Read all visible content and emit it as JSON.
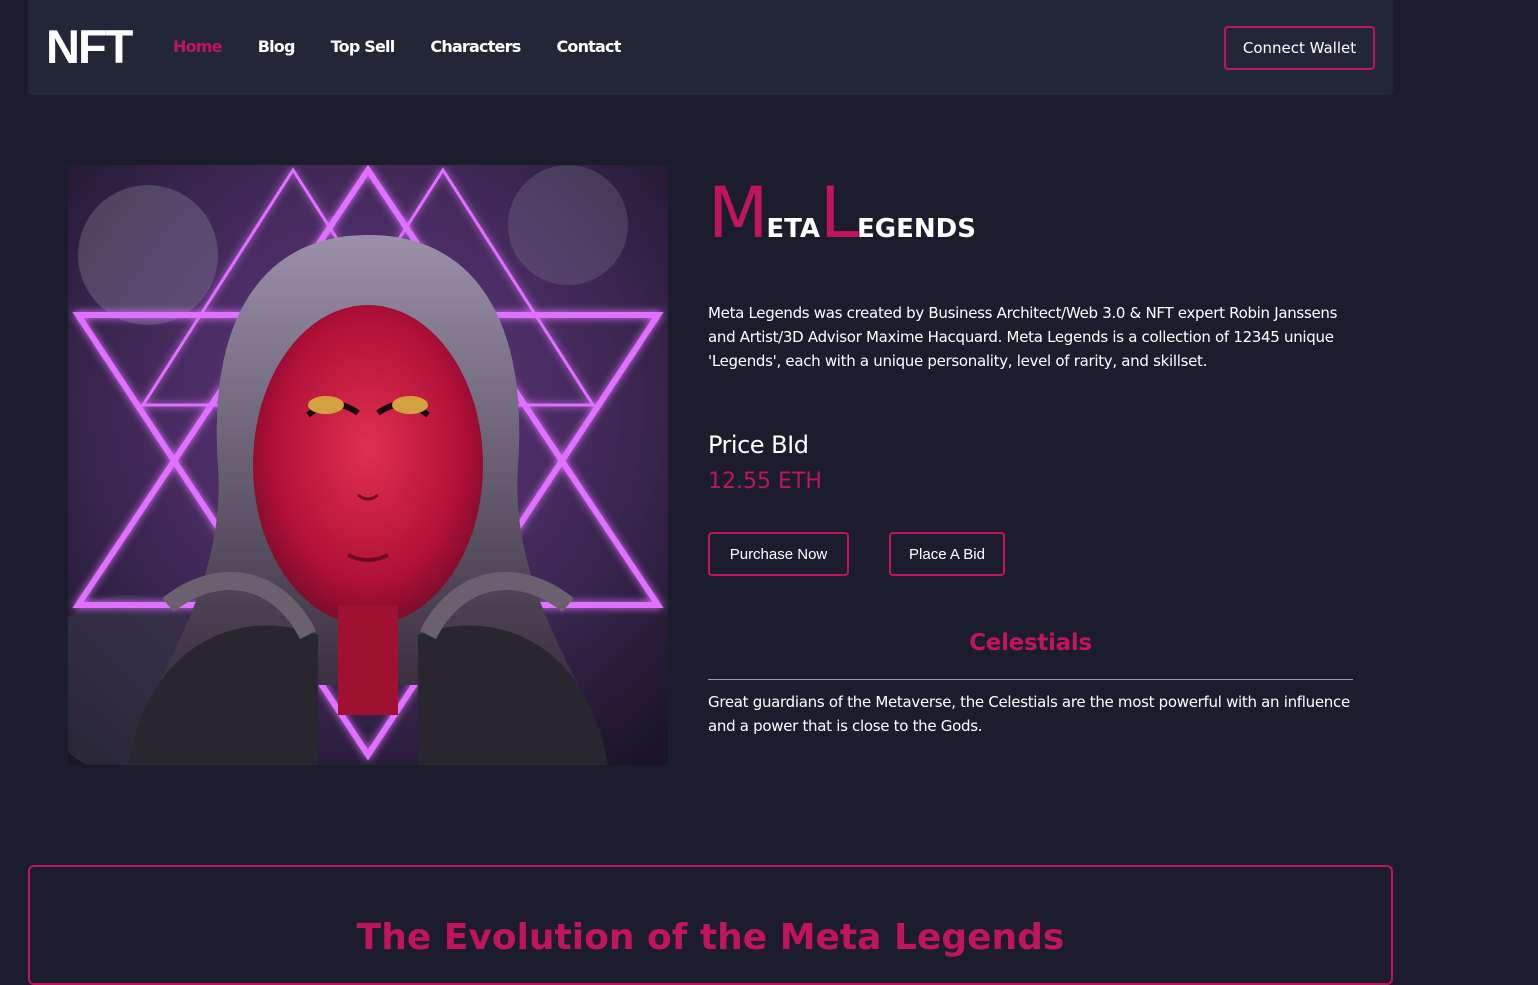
{
  "nav": {
    "logo": "NFT",
    "links": [
      {
        "label": "Home",
        "active": true
      },
      {
        "label": "Blog",
        "active": false
      },
      {
        "label": "Top Sell",
        "active": false
      },
      {
        "label": "Characters",
        "active": false
      },
      {
        "label": "Contact",
        "active": false
      }
    ],
    "connect_label": "Connect Wallet"
  },
  "hero": {
    "title_word1_cap": "M",
    "title_word1_rest": "ETA",
    "title_word2_cap": "L",
    "title_word2_rest": "EGENDS",
    "description": "Meta Legends was created by Business Architect/Web 3.0 & NFT expert Robin Janssens and Artist/3D Advisor Maxime Hacquard. Meta Legends is a collection of 12345 unique 'Legends', each with a unique personality, level of rarity, and skillset.",
    "price_label": "Price BId",
    "price_value": "12.55 ETH",
    "purchase_label": "Purchase Now",
    "bid_label": "Place A Bid",
    "category_title": "Celestials",
    "category_description": "Great guardians of the Metaverse, the Celestials are the most powerful with an influence and a power that is close to the Gods."
  },
  "evolution": {
    "title": "The Evolution of the Meta Legends"
  },
  "colors": {
    "accent": "#c0155c",
    "background": "#1b1d2c",
    "navbar": "#232637"
  }
}
